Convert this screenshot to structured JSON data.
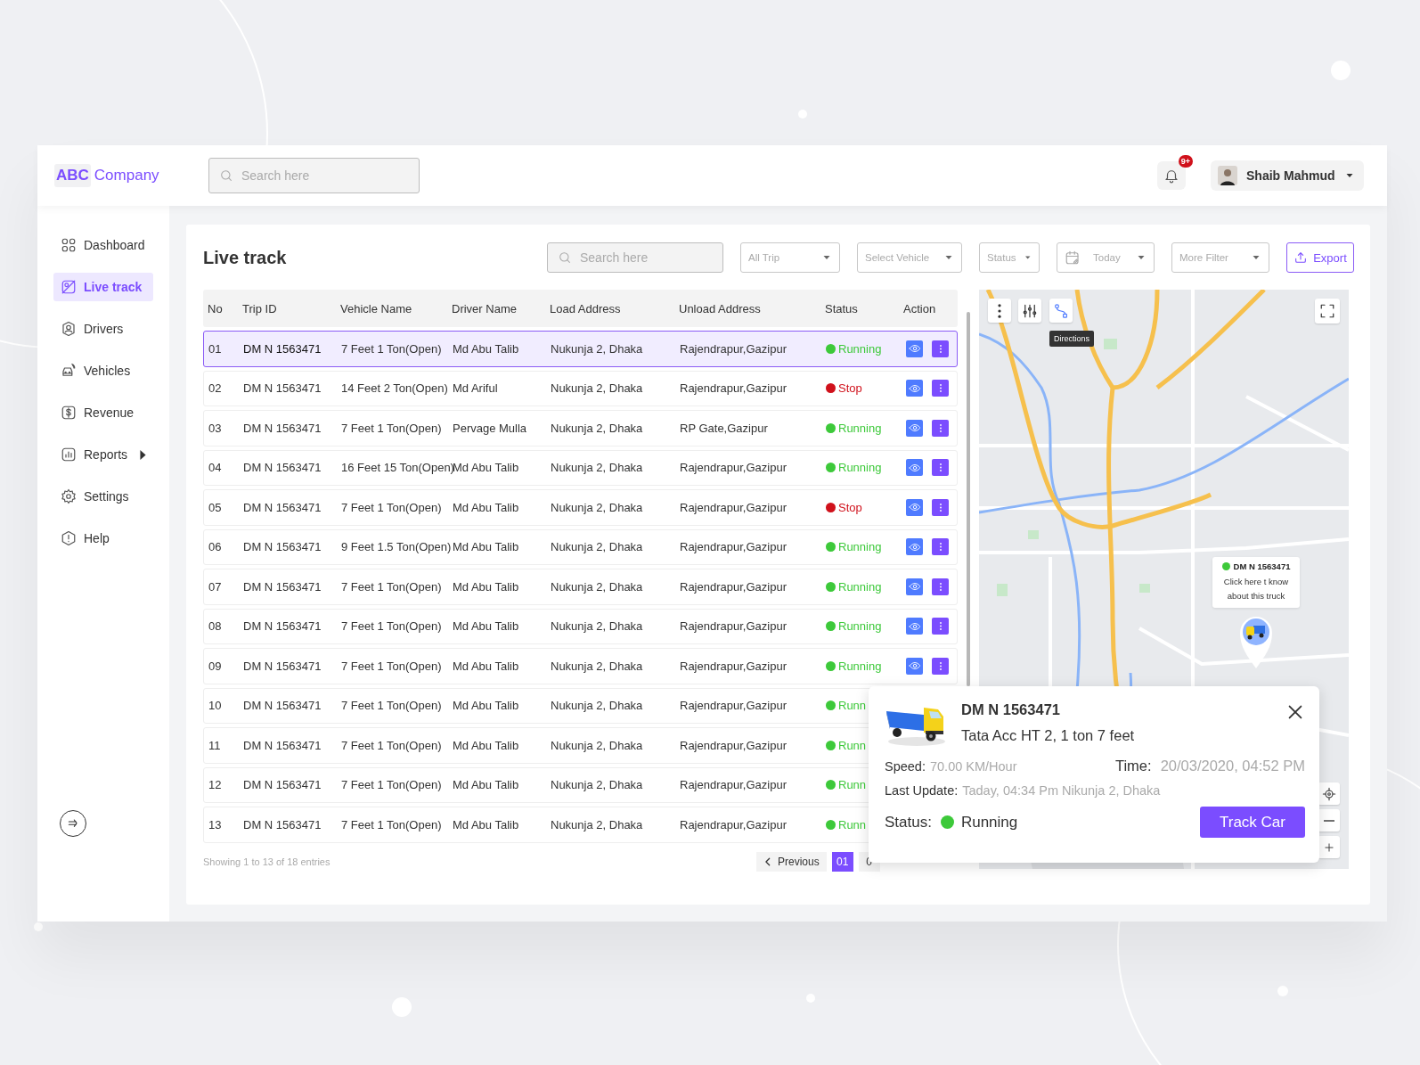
{
  "brand": {
    "abbr": "ABC",
    "name": "Company"
  },
  "header": {
    "search_placeholder": "Search here",
    "notification_badge": "9+",
    "user_name": "Shaib Mahmud"
  },
  "sidebar": {
    "items": [
      {
        "label": "Dashboard",
        "selected": false
      },
      {
        "label": "Live track",
        "selected": true
      },
      {
        "label": "Drivers",
        "selected": false
      },
      {
        "label": "Vehicles",
        "selected": false
      },
      {
        "label": "Revenue",
        "selected": false
      },
      {
        "label": "Reports",
        "selected": false,
        "submenu": true
      },
      {
        "label": "Settings",
        "selected": false
      },
      {
        "label": "Help",
        "selected": false
      }
    ]
  },
  "page": {
    "title": "Live track"
  },
  "toolbar": {
    "search_placeholder": "Search here",
    "filters": [
      {
        "label": "All Trip",
        "kind": "dropdown"
      },
      {
        "label": "Select Vehicle",
        "kind": "dropdown"
      },
      {
        "label": "Status",
        "kind": "dropdown"
      },
      {
        "label": "Today",
        "kind": "date"
      },
      {
        "label": "More Filter",
        "kind": "dropdown"
      }
    ],
    "export_label": "Export"
  },
  "table": {
    "columns": [
      "No",
      "Trip ID",
      "Vehicle Name",
      "Driver Name",
      "Load Address",
      "Unload Address",
      "Status",
      "Action"
    ],
    "rows": [
      {
        "no": "01",
        "trip_id": "DM N 1563471",
        "vehicle": "7 Feet 1 Ton(Open)",
        "driver": "Md Abu Talib",
        "load": "Nukunja 2, Dhaka",
        "unload": "Rajendrapur,Gazipur",
        "status": "Running",
        "color": "#3dc93a",
        "selected": true,
        "actions": [
          {
            "kind": "view"
          },
          {
            "kind": "more"
          }
        ]
      },
      {
        "no": "02",
        "trip_id": "DM N 1563471",
        "vehicle": "14 Feet 2 Ton(Open)",
        "driver": "Md Ariful",
        "load": "Nukunja 2, Dhaka",
        "unload": "Rajendrapur,Gazipur",
        "status": "Stop",
        "color": "#d0111b",
        "selected": false,
        "actions": [
          {
            "kind": "view"
          },
          {
            "kind": "more"
          }
        ]
      },
      {
        "no": "03",
        "trip_id": "DM N 1563471",
        "vehicle": "7 Feet 1 Ton(Open)",
        "driver": "Pervage Mulla",
        "load": "Nukunja 2, Dhaka",
        "unload": "RP Gate,Gazipur",
        "status": "Running",
        "color": "#3dc93a",
        "selected": false,
        "actions": [
          {
            "kind": "view"
          },
          {
            "kind": "more"
          }
        ]
      },
      {
        "no": "04",
        "trip_id": "DM N 1563471",
        "vehicle": "16 Feet 15 Ton(Open)",
        "driver": "Md Abu Talib",
        "load": "Nukunja 2, Dhaka",
        "unload": "Rajendrapur,Gazipur",
        "status": "Running",
        "color": "#3dc93a",
        "selected": false,
        "actions": [
          {
            "kind": "view"
          },
          {
            "kind": "more"
          }
        ]
      },
      {
        "no": "05",
        "trip_id": "DM N 1563471",
        "vehicle": "7 Feet 1 Ton(Open)",
        "driver": "Md Abu Talib",
        "load": "Nukunja 2, Dhaka",
        "unload": "Rajendrapur,Gazipur",
        "status": "Stop",
        "color": "#d0111b",
        "selected": false,
        "actions": [
          {
            "kind": "view"
          },
          {
            "kind": "more"
          }
        ]
      },
      {
        "no": "06",
        "trip_id": "DM N 1563471",
        "vehicle": "9 Feet 1.5 Ton(Open)",
        "driver": "Md Abu Talib",
        "load": "Nukunja 2, Dhaka",
        "unload": "Rajendrapur,Gazipur",
        "status": "Running",
        "color": "#3dc93a",
        "selected": false,
        "actions": [
          {
            "kind": "view"
          },
          {
            "kind": "more"
          }
        ]
      },
      {
        "no": "07",
        "trip_id": "DM N 1563471",
        "vehicle": "7 Feet 1 Ton(Open)",
        "driver": "Md Abu Talib",
        "load": "Nukunja 2, Dhaka",
        "unload": "Rajendrapur,Gazipur",
        "status": "Running",
        "color": "#3dc93a",
        "selected": false,
        "actions": [
          {
            "kind": "view"
          },
          {
            "kind": "more"
          }
        ]
      },
      {
        "no": "08",
        "trip_id": "DM N 1563471",
        "vehicle": "7 Feet 1 Ton(Open)",
        "driver": "Md Abu Talib",
        "load": "Nukunja 2, Dhaka",
        "unload": "Rajendrapur,Gazipur",
        "status": "Running",
        "color": "#3dc93a",
        "selected": false,
        "actions": [
          {
            "kind": "view"
          },
          {
            "kind": "more"
          }
        ]
      },
      {
        "no": "09",
        "trip_id": "DM N 1563471",
        "vehicle": "7 Feet 1 Ton(Open)",
        "driver": "Md Abu Talib",
        "load": "Nukunja 2, Dhaka",
        "unload": "Rajendrapur,Gazipur",
        "status": "Running",
        "color": "#3dc93a",
        "selected": false,
        "actions": [
          {
            "kind": "view"
          },
          {
            "kind": "more"
          }
        ]
      },
      {
        "no": "10",
        "trip_id": "DM N 1563471",
        "vehicle": "7 Feet 1 Ton(Open)",
        "driver": "Md Abu Talib",
        "load": "Nukunja 2, Dhaka",
        "unload": "Rajendrapur,Gazipur",
        "status": "Runn",
        "color": "#3dc93a",
        "selected": false
      },
      {
        "no": "11",
        "trip_id": "DM N 1563471",
        "vehicle": "7 Feet 1 Ton(Open)",
        "driver": "Md Abu Talib",
        "load": "Nukunja 2, Dhaka",
        "unload": "Rajendrapur,Gazipur",
        "status": "Runn",
        "color": "#3dc93a",
        "selected": false
      },
      {
        "no": "12",
        "trip_id": "DM N 1563471",
        "vehicle": "7 Feet 1 Ton(Open)",
        "driver": "Md Abu Talib",
        "load": "Nukunja 2, Dhaka",
        "unload": "Rajendrapur,Gazipur",
        "status": "Runn",
        "color": "#3dc93a",
        "selected": false
      },
      {
        "no": "13",
        "trip_id": "DM N 1563471",
        "vehicle": "7 Feet 1 Ton(Open)",
        "driver": "Md Abu Talib",
        "load": "Nukunja 2, Dhaka",
        "unload": "Rajendrapur,Gazipur",
        "status": "Runn",
        "color": "#3dc93a",
        "selected": false
      }
    ]
  },
  "footer": {
    "summary": "Showing 1 to 13 of 18 entries",
    "previous": "Previous",
    "pages": [
      {
        "label": "01",
        "selected": true
      },
      {
        "label": "0",
        "selected": false
      }
    ]
  },
  "map": {
    "tooltip": "Directions",
    "marker": {
      "trip_id": "DM N 1563471",
      "color": "#3dc93a",
      "note": "Click here t know about this truck"
    }
  },
  "popup": {
    "trip_id": "DM N 1563471",
    "vehicle_model": "Tata Acc HT 2, 1 ton 7 feet",
    "speed_label": "Speed:",
    "speed": "70.00 KM/Hour",
    "time_label": "Time:",
    "time": "20/03/2020, 04:52 PM",
    "update_label": "Last Update:",
    "update": "Taday, 04:34 Pm Nikunja 2, Dhaka",
    "status_label": "Status:",
    "status": "Running",
    "color": "#3dc93a",
    "button": "Track Car"
  }
}
